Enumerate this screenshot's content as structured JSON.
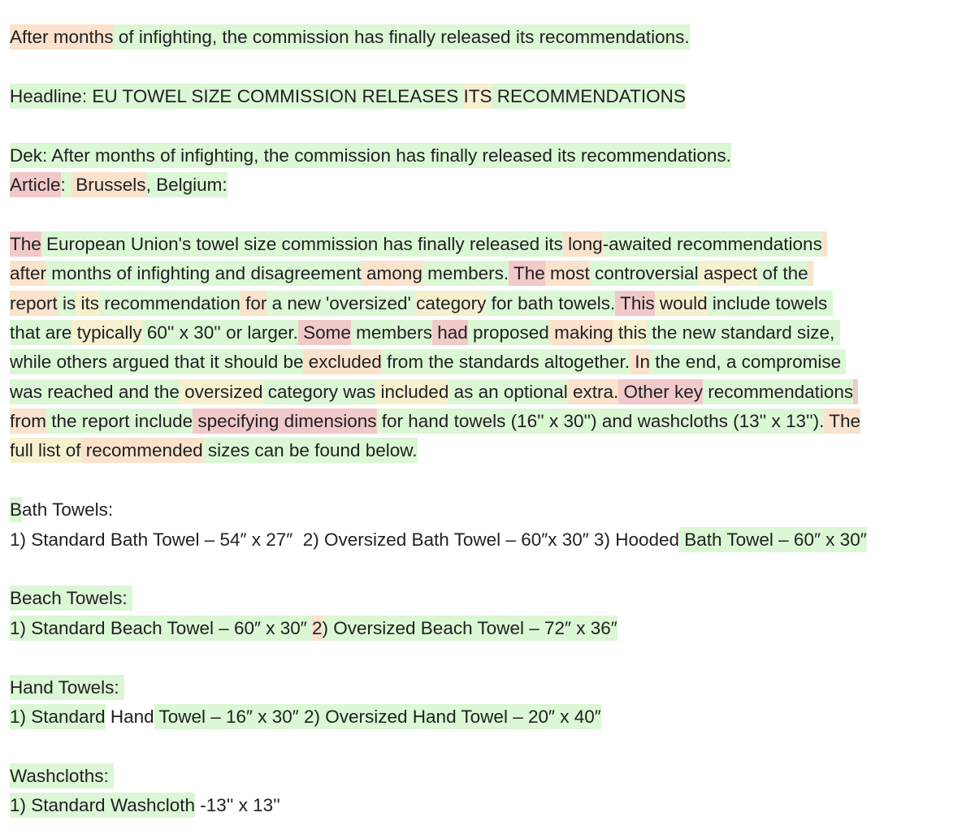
{
  "legend_colors": {
    "g": "#dcf7d5",
    "y": "#f6f0cf",
    "o": "#fae2cd",
    "r": "#f2c9c9"
  },
  "lines": [
    [
      [
        "After months",
        "o"
      ],
      [
        " of infighting, the commission has finally released its recommendations.",
        "g"
      ]
    ],
    [],
    [
      [
        "Headline: EU TOWEL SIZE COMMISSION RELEASES ",
        "g"
      ],
      [
        "ITS",
        "y"
      ],
      [
        " RECOMMENDATIONS",
        "g"
      ]
    ],
    [],
    [
      [
        "Dek: After months of infighting, the commission has finally released its recommendations.",
        "g"
      ]
    ],
    [
      [
        "Article",
        "r"
      ],
      [
        ": ",
        "g"
      ],
      [
        " Brussels",
        "o"
      ],
      [
        ", Belgium:",
        "g"
      ]
    ],
    [],
    [
      [
        "The",
        "r"
      ],
      [
        " European Union's towel size commission has finally released its",
        "g"
      ],
      [
        " long",
        "o"
      ],
      [
        "-awaited recommendations",
        "g"
      ],
      [
        " ",
        "o"
      ]
    ],
    [
      [
        "after",
        "o"
      ],
      [
        " months of infighting and disagreement",
        "g"
      ],
      [
        " among",
        "o"
      ],
      [
        " members.",
        "g"
      ],
      [
        " The",
        "r"
      ],
      [
        " most",
        "o"
      ],
      [
        " controversial",
        "g"
      ],
      [
        " aspect",
        "y"
      ],
      [
        " of the",
        "g"
      ],
      [
        " ",
        "o"
      ]
    ],
    [
      [
        "report",
        "o"
      ],
      [
        " is",
        "g"
      ],
      [
        " its",
        "y"
      ],
      [
        " recommendation",
        "g"
      ],
      [
        " for",
        "o"
      ],
      [
        " a new 'oversized' ",
        "g"
      ],
      [
        "category",
        "y"
      ],
      [
        " for bath towels.",
        "g"
      ],
      [
        " This",
        "r"
      ],
      [
        " would",
        "y"
      ],
      [
        " include towels",
        "g"
      ],
      [
        " ",
        "g"
      ]
    ],
    [
      [
        "that are",
        "g"
      ],
      [
        " typically",
        "y"
      ],
      [
        " 60'' x 30'' or larger.",
        "g"
      ],
      [
        " Some",
        "r"
      ],
      [
        " members",
        "g"
      ],
      [
        " had",
        "r"
      ],
      [
        " proposed",
        "g"
      ],
      [
        " making",
        "o"
      ],
      [
        " this",
        "y"
      ],
      [
        " the new standard size,",
        "g"
      ],
      [
        " ",
        "g"
      ]
    ],
    [
      [
        "while others argued that it should be",
        "g"
      ],
      [
        " excluded",
        "o"
      ],
      [
        " from the standards altogether.",
        "g"
      ],
      [
        " In",
        "o"
      ],
      [
        " the end, a compromise",
        "g"
      ],
      [
        " ",
        "g"
      ]
    ],
    [
      [
        "was reached and the",
        "g"
      ],
      [
        " oversized",
        "y"
      ],
      [
        " category was",
        "g"
      ],
      [
        " included",
        "y"
      ],
      [
        " as an optional",
        "g"
      ],
      [
        " extra.",
        "o"
      ],
      [
        " Other key",
        "r"
      ],
      [
        " recommendations",
        "g"
      ],
      [
        " ",
        "r"
      ]
    ],
    [
      [
        "from",
        "o"
      ],
      [
        " the report include",
        "g"
      ],
      [
        " specifying dimensions",
        "r"
      ],
      [
        " for hand towels (16'' x 30'') and washcloths (13'' x 13'').",
        "g"
      ],
      [
        " The",
        "o"
      ]
    ],
    [
      [
        "full list of",
        "y"
      ],
      [
        " recommended",
        "o"
      ],
      [
        " sizes can be found below.",
        "g"
      ]
    ],
    [],
    [
      [
        "B",
        "g"
      ],
      [
        "ath Towels:",
        "n"
      ]
    ],
    [
      [
        "1) Standard Bath Towel – 54″ x 27″  2) Oversized Bath Towel – 60″x 30″ 3) Hooded",
        "n"
      ],
      [
        " Bath Towel – 60″ x 30″",
        "g"
      ]
    ],
    [],
    [
      [
        "Beach Towels: ",
        "g"
      ]
    ],
    [
      [
        "1) Standard Beach Towel – 60″ x 30″ ",
        "g"
      ],
      [
        "2",
        "o"
      ],
      [
        ") Oversized Beach Towel – 72″ x 36″",
        "g"
      ]
    ],
    [],
    [
      [
        "Hand Towels: ",
        "g"
      ]
    ],
    [
      [
        "1) Standard",
        "g"
      ],
      [
        " Hand",
        "n"
      ],
      [
        " Towel – 16″ x 30″ 2) Oversized Hand Towel – 20″ x 40″",
        "g"
      ]
    ],
    [],
    [
      [
        "Washcloths: ",
        "g"
      ]
    ],
    [
      [
        "1) Standard Washcloth",
        "g"
      ],
      [
        " -13'' x 13''",
        "n"
      ]
    ]
  ]
}
